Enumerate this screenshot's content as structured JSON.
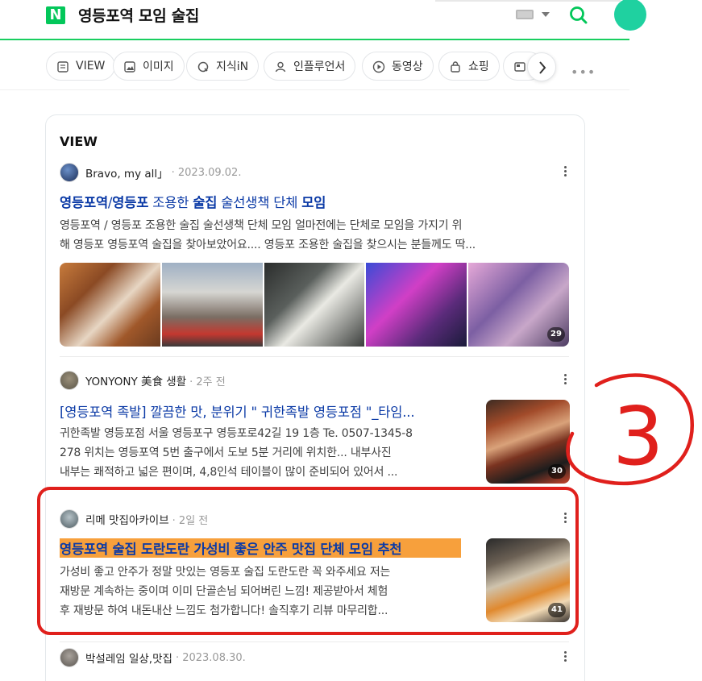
{
  "search": {
    "logo": "N",
    "query": "영등포역 모임 술집"
  },
  "tabs": [
    {
      "label": "VIEW",
      "icon": "document-icon"
    },
    {
      "label": "이미지",
      "icon": "image-icon"
    },
    {
      "label": "지식iN",
      "icon": "q-icon"
    },
    {
      "label": "인플루언서",
      "icon": "person-icon"
    },
    {
      "label": "동영상",
      "icon": "play-icon"
    },
    {
      "label": "쇼핑",
      "icon": "bag-icon"
    }
  ],
  "section": {
    "title": "VIEW"
  },
  "posts": [
    {
      "author": "Bravo, my all」",
      "date": "2023.09.02.",
      "title_parts": [
        "영등포역",
        "/",
        "영등포",
        " 조용한 ",
        "술집",
        " 술선생책 단체 ",
        "모임"
      ],
      "desc_line1": "영등포역 / 영등포 조용한 술집 술선생책 단체 모임 얼마전에는 단체로 모임을 가지기 위",
      "desc_line2": "해 영등포 영등포역 술집을 찾아보았어요.... 영등포 조용한 술집을 찾으시는 분들께도 딱...",
      "image_count": "29"
    },
    {
      "author": "YONYONY 美食 생활",
      "date": "2주 전",
      "title": "[영등포역 족발] 깔끔한 맛, 분위기 \" 귀한족발 영등포점 \"_타임...",
      "desc_line1": "귀한족발 영등포점 서울 영등포구 영등포로42길 19 1층 Te. 0507-1345-8",
      "desc_line2": "278 위치는 영등포역 5번 출구에서 도보 5분 거리에 위치한... 내부사진",
      "desc_line3": "내부는 쾌적하고 넓은 편이며, 4,8인석 테이블이 많이 준비되어 있어서 ...",
      "image_count": "30"
    },
    {
      "author": "리메 맛집아카이브",
      "date": "2일 전",
      "title": "영등포역 술집 도란도란 가성비 좋은 안주 맛집 단체 모임 추천",
      "desc_line1": "가성비 좋고 안주가 정말 맛있는 영등포 술집 도란도란 꼭 와주세요 저는",
      "desc_line2": "재방문 계속하는 중이며 이미 단골손님 되어버린 느낌! 제공받아서 체험",
      "desc_line3": "후 재방문 하여 내돈내산 느낌도 첨가합니다! 솔직후기 리뷰 마무리합...",
      "image_count": "41"
    },
    {
      "author": "박설레임 일상,맛집",
      "date": "2023.08.30."
    }
  ],
  "annotation": {
    "number": "3",
    "color": "#e0201c"
  },
  "colors": {
    "brand": "#03c75a",
    "link": "#0b3aa6",
    "highlight": "#f7a03c"
  }
}
